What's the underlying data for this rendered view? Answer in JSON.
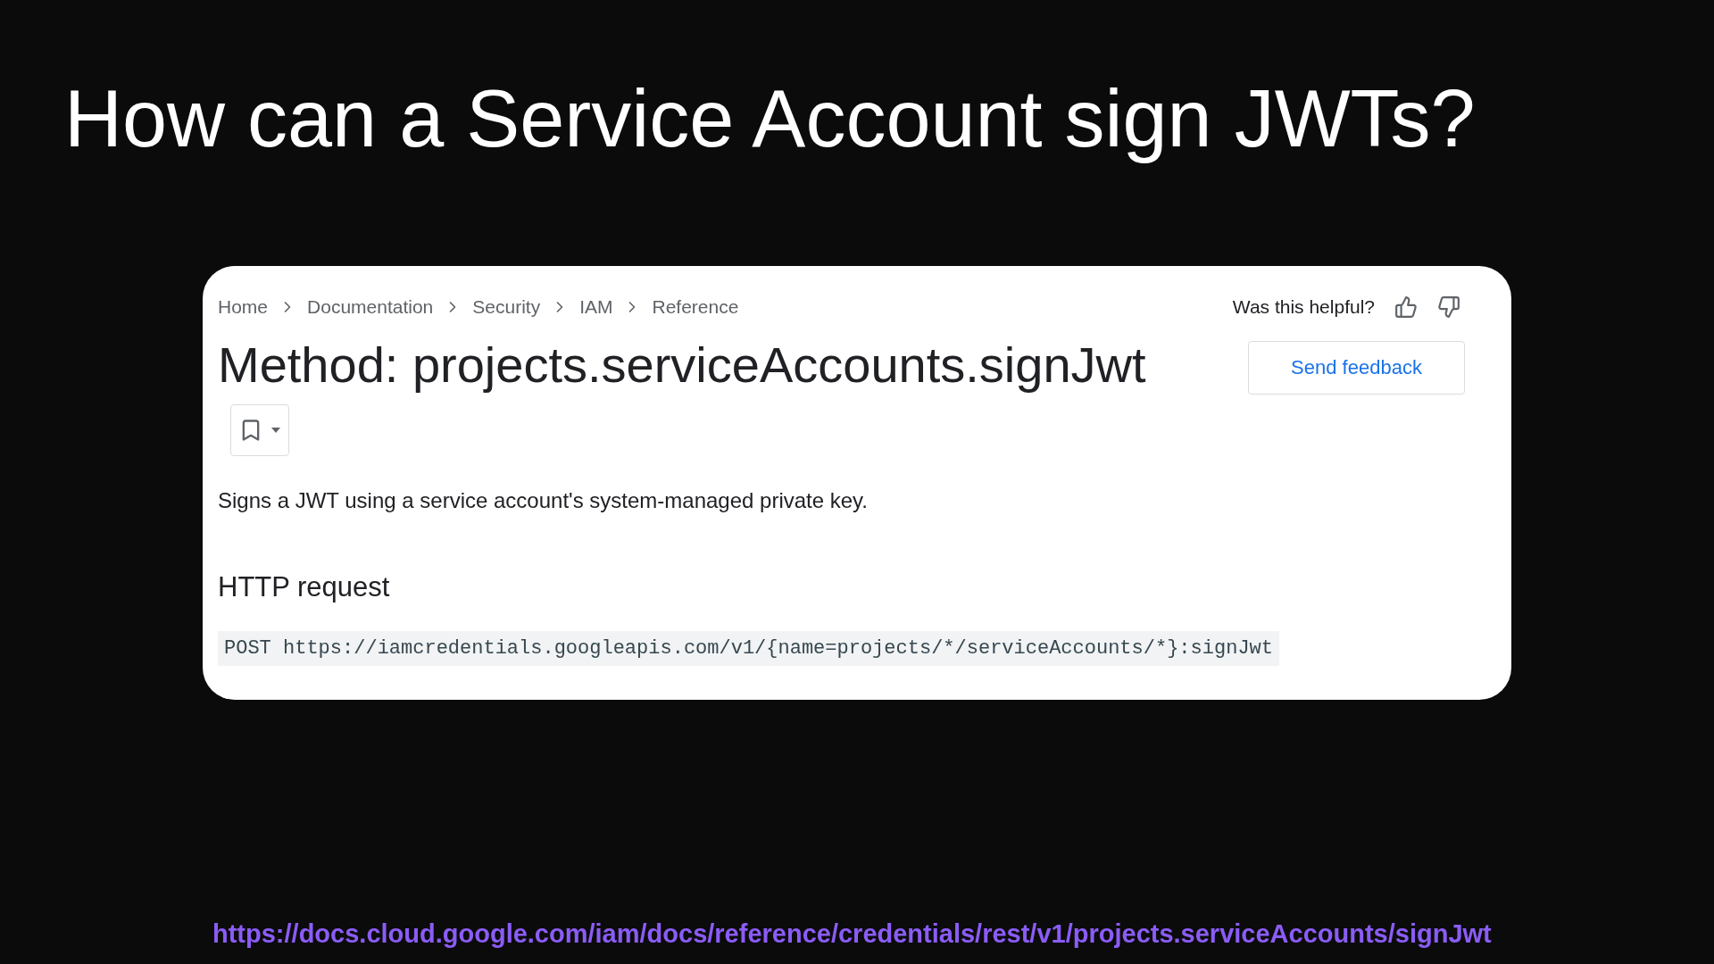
{
  "slide_title": "How can a Service Account sign JWTs?",
  "page": {
    "breadcrumbs": [
      "Home",
      "Documentation",
      "Security",
      "IAM",
      "Reference"
    ],
    "helpful_prompt": "Was this helpful?",
    "feedback_button": "Send feedback",
    "heading": "Method: projects.serviceAccounts.signJwt",
    "description": "Signs a JWT using a service account's system-managed private key.",
    "section_heading": "HTTP request",
    "request": "POST https://iamcredentials.googleapis.com/v1/{name=projects/*/serviceAccounts/*}:signJwt"
  },
  "source_link": "https://docs.cloud.google.com/iam/docs/reference/credentials/rest/v1/projects.serviceAccounts/signJwt"
}
